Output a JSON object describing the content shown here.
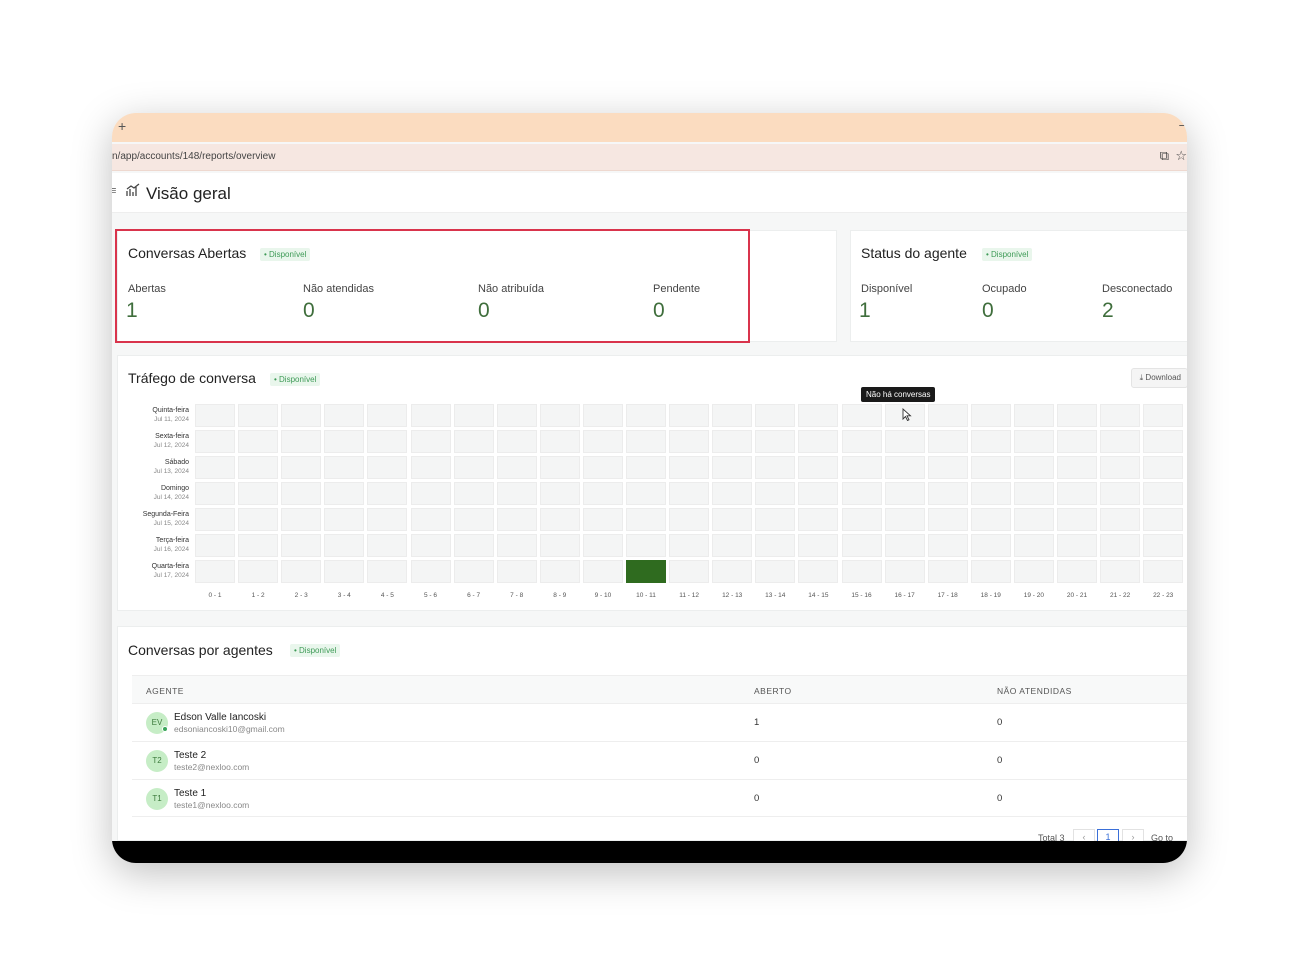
{
  "browser": {
    "url": "n/app/accounts/148/reports/overview",
    "tab_plus": "+",
    "minimize": "–"
  },
  "header": {
    "title": "Visão geral",
    "menu_glyph": "≡"
  },
  "badge_text": "• Disponível",
  "open_conversations": {
    "title": "Conversas Abertas",
    "metrics": [
      {
        "label": "Abertas",
        "value": "1"
      },
      {
        "label": "Não atendidas",
        "value": "0"
      },
      {
        "label": "Não atribuída",
        "value": "0"
      },
      {
        "label": "Pendente",
        "value": "0"
      }
    ]
  },
  "agent_status": {
    "title": "Status do agente",
    "metrics": [
      {
        "label": "Disponível",
        "value": "1"
      },
      {
        "label": "Ocupado",
        "value": "0"
      },
      {
        "label": "Desconectado",
        "value": "2"
      }
    ]
  },
  "traffic": {
    "title": "Tráfego de conversa",
    "download_label": "Download",
    "tooltip": "Não há conversas",
    "rows": [
      {
        "day": "Quinta-feira",
        "date": "Jul 11, 2024"
      },
      {
        "day": "Sexta-feira",
        "date": "Jul 12, 2024"
      },
      {
        "day": "Sábado",
        "date": "Jul 13, 2024"
      },
      {
        "day": "Domingo",
        "date": "Jul 14, 2024"
      },
      {
        "day": "Segunda-Feira",
        "date": "Jul 15, 2024"
      },
      {
        "day": "Terça-feira",
        "date": "Jul 16, 2024"
      },
      {
        "day": "Quarta-feira",
        "date": "Jul 17, 2024"
      }
    ],
    "hours": [
      "0 - 1",
      "1 - 2",
      "2 - 3",
      "3 - 4",
      "4 - 5",
      "5 - 6",
      "6 - 7",
      "7 - 8",
      "8 - 9",
      "9 - 10",
      "10 - 11",
      "11 - 12",
      "12 - 13",
      "13 - 14",
      "14 - 15",
      "15 - 16",
      "16 - 17",
      "17 - 18",
      "18 - 19",
      "19 - 20",
      "20 - 21",
      "21 - 22",
      "22 - 23"
    ],
    "active_cells": [
      {
        "row": 6,
        "hour": 10,
        "count": 1
      }
    ]
  },
  "agents": {
    "title": "Conversas por agentes",
    "columns": [
      "AGENTE",
      "ABERTO",
      "NÃO ATENDIDAS"
    ],
    "rows": [
      {
        "initials": "EV",
        "name": "Edson Valle Iancoski",
        "email": "edsoniancoski10@gmail.com",
        "open": "1",
        "unattended": "0",
        "online": true
      },
      {
        "initials": "T2",
        "name": "Teste 2",
        "email": "teste2@nexloo.com",
        "open": "0",
        "unattended": "0",
        "online": false
      },
      {
        "initials": "T1",
        "name": "Teste 1",
        "email": "teste1@nexloo.com",
        "open": "0",
        "unattended": "0",
        "online": false
      }
    ],
    "pagination": {
      "total": "Total 3",
      "current_page": "1",
      "goto": "Go to"
    }
  },
  "colors": {
    "accent_green": "#3f6e3c",
    "heat_active": "#2f6b1f",
    "highlight_red": "#d9344c",
    "tab_bar": "#fbdcc0"
  }
}
